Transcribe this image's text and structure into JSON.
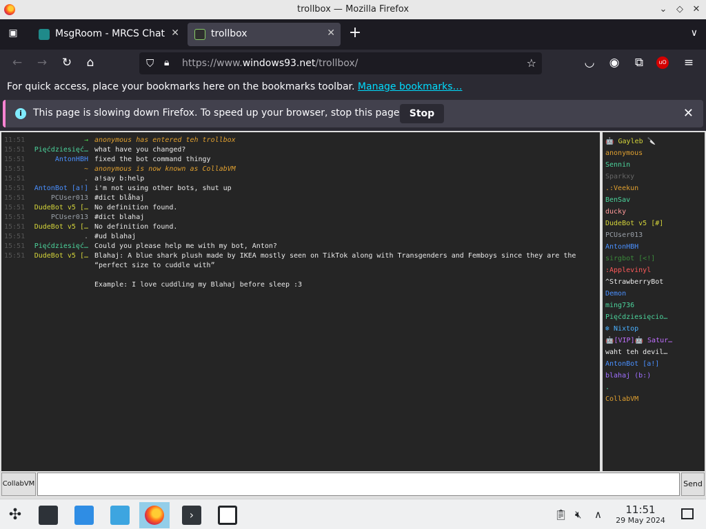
{
  "window": {
    "title": "trollbox — Mozilla Firefox"
  },
  "tabs": [
    {
      "label": "MsgRoom - MRCS Chat"
    },
    {
      "label": "trollbox"
    }
  ],
  "navbar": {
    "url_prefix": "https://www.",
    "url_domain": "windows93.net",
    "url_path": "/trollbox/",
    "badge": "uO"
  },
  "bookmarks": {
    "text": "For quick access, place your bookmarks here on the bookmarks toolbar.",
    "link": "Manage bookmarks…"
  },
  "notification": {
    "message": "This page is slowing down Firefox. To speed up your browser, stop this page.",
    "stop_label": "Stop"
  },
  "chat": {
    "messages": [
      {
        "time": "11:51",
        "nick": "→",
        "nick_color": "#4cd44c",
        "text": "anonymous has entered teh trollbox",
        "text_color": "#e0a030",
        "italic": true
      },
      {
        "time": "15:51",
        "nick": "Pięćdziesięć…",
        "nick_color": "#4cd49c",
        "text": "what have you changed?"
      },
      {
        "time": "15:51",
        "nick": "AntonHBH",
        "nick_color": "#4a90ff",
        "text": "fixed the bot command thingy"
      },
      {
        "time": "15:51",
        "nick": "~",
        "nick_color": "#e0a030",
        "text": "anonymous is now known as CollabVM",
        "text_color": "#e0a030",
        "italic": true
      },
      {
        "time": "15:51",
        "nick": ".",
        "nick_color": "#aaaaaa",
        "text": "a!say b:help"
      },
      {
        "time": "15:51",
        "nick": "AntonBot [a!]",
        "nick_color": "#4a90ff",
        "text": "i'm not using other bots, shut up"
      },
      {
        "time": "15:51",
        "nick": "PCUser013",
        "nick_color": "#9aa0a8",
        "text": "#dict blåhaj"
      },
      {
        "time": "15:51",
        "nick": "DudeBot v5 […",
        "nick_color": "#d4d43a",
        "text": "No definition found."
      },
      {
        "time": "15:51",
        "nick": "PCUser013",
        "nick_color": "#9aa0a8",
        "text": "#dict blahaj"
      },
      {
        "time": "15:51",
        "nick": "DudeBot v5 […",
        "nick_color": "#d4d43a",
        "text": "No definition found."
      },
      {
        "time": "15:51",
        "nick": ".",
        "nick_color": "#aaaaaa",
        "text": "#ud blahaj"
      },
      {
        "time": "15:51",
        "nick": "Pięćdziesięć…",
        "nick_color": "#4cd49c",
        "text": "Could you please help me with my bot, Anton?"
      },
      {
        "time": "15:51",
        "nick": "DudeBot v5 […",
        "nick_color": "#d4d43a",
        "text": "Blahaj: A blue shark plush made by IKEA mostly seen on TikTok along with Transgenders and Femboys since they are the"
      },
      {
        "time": "",
        "nick": "",
        "nick_color": "#d4d43a",
        "text": "“perfect size to cuddle with”"
      },
      {
        "time": "",
        "nick": "",
        "nick_color": "#d4d43a",
        "text": ""
      },
      {
        "time": "",
        "nick": "",
        "nick_color": "#d4d43a",
        "text": "Example: I love cuddling my Blahaj before sleep :3"
      }
    ],
    "users": [
      {
        "name": "🤖 Gayleb 🔪",
        "color": "#d4d43a"
      },
      {
        "name": "anonymous",
        "color": "#e0a030"
      },
      {
        "name": "Sennin",
        "color": "#4cd49c"
      },
      {
        "name": "Sparkxy",
        "color": "#666666"
      },
      {
        "name": ".:Veekun",
        "color": "#e0a030"
      },
      {
        "name": "BenSav",
        "color": "#4cd49c"
      },
      {
        "name": "ducky",
        "color": "#ff9a9a"
      },
      {
        "name": "DudeBot v5 [#]",
        "color": "#d4d43a"
      },
      {
        "name": "PCUser013",
        "color": "#9aa0a8"
      },
      {
        "name": "AntonHBH",
        "color": "#4a90ff"
      },
      {
        "name": "sirgbot [<!]",
        "color": "#3a8a3a"
      },
      {
        "name": ":Applevinyl",
        "color": "#ff5a5a"
      },
      {
        "name": "^StrawberryBot",
        "color": "#eaeaea"
      },
      {
        "name": "Demon",
        "color": "#4a90ff"
      },
      {
        "name": "ming736",
        "color": "#4cd49c"
      },
      {
        "name": "Pięćdziesięcio…",
        "color": "#4cd49c"
      },
      {
        "name": "❄ Nixtop",
        "color": "#4ab0ff"
      },
      {
        "name": "🤖[VIP]🤖 Satur…",
        "color": "#c070ff"
      },
      {
        "name": "waht teh devil…",
        "color": "#eaeaea"
      },
      {
        "name": "AntonBot [a!]",
        "color": "#4a90ff"
      },
      {
        "name": "blahaj (b:)",
        "color": "#a070ff"
      },
      {
        "name": ".",
        "color": "#4cd49c"
      },
      {
        "name": "CollabVM",
        "color": "#e0a030"
      }
    ],
    "username_label": "CollabVM",
    "input_value": "",
    "send_label": "Send"
  },
  "taskbar": {
    "time": "11:51",
    "date": "29 May 2024"
  }
}
